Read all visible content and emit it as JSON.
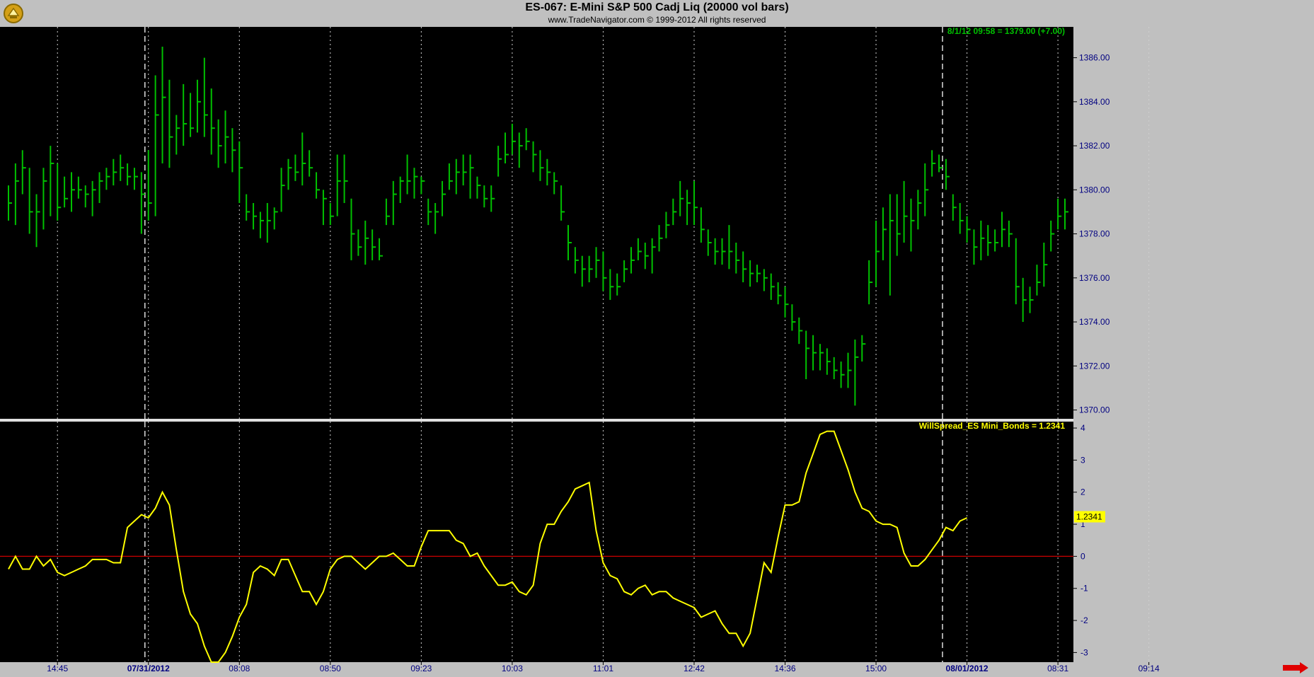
{
  "header": {
    "title": "ES-067:  E-Mini S&P 500 Cadj Liq  (20000 vol bars)",
    "subtitle": "www.TradeNavigator.com © 1999-2012  All rights reserved"
  },
  "icons": {
    "logo": "trade-navigator-logo-icon",
    "scroll_right": "arrow-right-icon"
  },
  "colors": {
    "background": "#000000",
    "frame": "#c0c0c0",
    "price_bars": "#00c000",
    "indicator": "#ffff00",
    "zero_line": "#cc0000",
    "axis_text": "#000080",
    "date_text": "#000080"
  },
  "chart_data": [
    {
      "type": "ohlc",
      "title": "ES-067:  E-Mini S&P 500 Cadj Liq  (20000 vol bars)",
      "last_value_label": "8/1/12 09:58 = 1379.00 (+7.00)",
      "ylim": [
        1369.6,
        1387.4
      ],
      "yticks": [
        "1370.00",
        "1372.00",
        "1374.00",
        "1376.00",
        "1378.00",
        "1380.00",
        "1382.00",
        "1384.00",
        "1386.00"
      ],
      "grid": "vertical dotted",
      "bars": [
        [
          1380.2,
          1378.6,
          1379.4
        ],
        [
          1381.2,
          1378.4,
          1380.4
        ],
        [
          1381.8,
          1379.8,
          1381.0
        ],
        [
          1381.0,
          1378.0,
          1379.0
        ],
        [
          1379.8,
          1377.4,
          1379.0
        ],
        [
          1381.0,
          1378.2,
          1380.4
        ],
        [
          1382.0,
          1378.8,
          1381.2
        ],
        [
          1381.2,
          1378.6,
          1379.2
        ],
        [
          1380.6,
          1379.2,
          1379.6
        ],
        [
          1380.8,
          1379.0,
          1380.0
        ],
        [
          1380.6,
          1379.6,
          1380.0
        ],
        [
          1380.2,
          1379.2,
          1379.8
        ],
        [
          1380.4,
          1378.8,
          1380.0
        ],
        [
          1380.8,
          1379.4,
          1380.4
        ],
        [
          1381.0,
          1380.0,
          1380.6
        ],
        [
          1381.4,
          1380.2,
          1380.8
        ],
        [
          1381.6,
          1380.4,
          1381.0
        ],
        [
          1381.2,
          1380.2,
          1380.6
        ],
        [
          1381.0,
          1380.0,
          1380.6
        ],
        [
          1380.8,
          1378.0,
          1379.8
        ],
        [
          1381.8,
          1378.6,
          1379.4
        ],
        [
          1385.2,
          1378.8,
          1383.4
        ],
        [
          1386.5,
          1381.2,
          1384.2
        ],
        [
          1385.0,
          1381.0,
          1382.4
        ],
        [
          1383.4,
          1381.6,
          1382.8
        ],
        [
          1384.8,
          1382.0,
          1383.0
        ],
        [
          1384.4,
          1382.4,
          1382.8
        ],
        [
          1385.0,
          1382.6,
          1384.0
        ],
        [
          1386.0,
          1382.4,
          1383.4
        ],
        [
          1384.6,
          1381.6,
          1382.8
        ],
        [
          1383.2,
          1381.0,
          1382.0
        ],
        [
          1383.6,
          1381.2,
          1382.4
        ],
        [
          1382.8,
          1380.8,
          1381.8
        ],
        [
          1382.2,
          1379.4,
          1381.0
        ],
        [
          1379.8,
          1378.6,
          1379.0
        ],
        [
          1379.4,
          1378.2,
          1378.8
        ],
        [
          1379.0,
          1377.8,
          1378.6
        ],
        [
          1379.4,
          1377.6,
          1378.6
        ],
        [
          1379.2,
          1378.2,
          1379.0
        ],
        [
          1381.0,
          1379.0,
          1380.2
        ],
        [
          1381.4,
          1380.0,
          1381.0
        ],
        [
          1381.6,
          1380.4,
          1380.8
        ],
        [
          1382.6,
          1380.2,
          1381.2
        ],
        [
          1381.8,
          1380.6,
          1381.0
        ],
        [
          1380.8,
          1379.6,
          1380.0
        ],
        [
          1380.0,
          1378.4,
          1379.6
        ],
        [
          1379.4,
          1378.4,
          1378.8
        ],
        [
          1381.6,
          1378.8,
          1380.4
        ],
        [
          1381.6,
          1379.4,
          1380.4
        ],
        [
          1379.6,
          1376.8,
          1378.0
        ],
        [
          1378.2,
          1377.0,
          1377.4
        ],
        [
          1378.6,
          1376.6,
          1377.8
        ],
        [
          1378.2,
          1376.8,
          1377.4
        ],
        [
          1377.8,
          1376.8,
          1377.0
        ],
        [
          1379.6,
          1378.4,
          1378.8
        ],
        [
          1380.4,
          1378.4,
          1379.8
        ],
        [
          1380.6,
          1379.4,
          1380.4
        ],
        [
          1381.6,
          1379.8,
          1380.4
        ],
        [
          1381.0,
          1379.6,
          1380.6
        ],
        [
          1380.6,
          1379.8,
          1380.4
        ],
        [
          1379.6,
          1378.4,
          1379.0
        ],
        [
          1379.4,
          1378.0,
          1379.0
        ],
        [
          1380.4,
          1378.8,
          1379.8
        ],
        [
          1381.2,
          1380.0,
          1380.4
        ],
        [
          1381.4,
          1379.8,
          1380.8
        ],
        [
          1381.6,
          1380.2,
          1380.8
        ],
        [
          1381.6,
          1379.6,
          1381.0
        ],
        [
          1380.6,
          1379.6,
          1380.2
        ],
        [
          1380.2,
          1379.2,
          1379.6
        ],
        [
          1380.2,
          1379.0,
          1379.6
        ],
        [
          1382.0,
          1380.6,
          1381.4
        ],
        [
          1382.6,
          1381.2,
          1381.6
        ],
        [
          1383.0,
          1381.6,
          1382.2
        ],
        [
          1382.6,
          1381.0,
          1382.0
        ],
        [
          1382.8,
          1381.8,
          1382.2
        ],
        [
          1382.2,
          1380.8,
          1381.6
        ],
        [
          1381.8,
          1380.4,
          1381.0
        ],
        [
          1381.4,
          1380.2,
          1380.8
        ],
        [
          1380.8,
          1379.8,
          1380.4
        ],
        [
          1380.2,
          1378.6,
          1379.0
        ],
        [
          1378.4,
          1376.8,
          1377.6
        ],
        [
          1377.4,
          1376.2,
          1376.8
        ],
        [
          1377.0,
          1375.6,
          1376.4
        ],
        [
          1377.0,
          1375.8,
          1376.4
        ],
        [
          1377.4,
          1376.0,
          1376.8
        ],
        [
          1377.2,
          1375.4,
          1376.0
        ],
        [
          1376.4,
          1375.0,
          1375.6
        ],
        [
          1376.2,
          1375.2,
          1375.6
        ],
        [
          1376.8,
          1375.8,
          1376.4
        ],
        [
          1377.4,
          1376.2,
          1376.8
        ],
        [
          1377.8,
          1376.8,
          1377.2
        ],
        [
          1377.6,
          1376.4,
          1377.0
        ],
        [
          1377.8,
          1376.2,
          1377.4
        ],
        [
          1378.4,
          1377.2,
          1377.8
        ],
        [
          1379.0,
          1377.8,
          1378.4
        ],
        [
          1379.6,
          1378.4,
          1379.0
        ],
        [
          1380.4,
          1378.8,
          1379.6
        ],
        [
          1380.0,
          1378.4,
          1379.4
        ],
        [
          1380.4,
          1378.4,
          1379.2
        ],
        [
          1379.2,
          1377.6,
          1378.2
        ],
        [
          1378.2,
          1377.0,
          1377.6
        ],
        [
          1377.8,
          1376.6,
          1377.2
        ],
        [
          1377.8,
          1376.6,
          1377.2
        ],
        [
          1378.4,
          1376.4,
          1377.2
        ],
        [
          1377.6,
          1376.2,
          1376.8
        ],
        [
          1377.2,
          1375.8,
          1376.4
        ],
        [
          1376.8,
          1375.6,
          1376.2
        ],
        [
          1376.6,
          1375.8,
          1376.2
        ],
        [
          1376.4,
          1375.4,
          1376.0
        ],
        [
          1376.2,
          1375.0,
          1375.6
        ],
        [
          1375.8,
          1374.8,
          1375.2
        ],
        [
          1375.6,
          1374.2,
          1374.8
        ],
        [
          1374.8,
          1373.6,
          1374.0
        ],
        [
          1374.2,
          1373.0,
          1373.6
        ],
        [
          1373.6,
          1371.4,
          1372.8
        ],
        [
          1373.4,
          1371.8,
          1372.6
        ],
        [
          1373.0,
          1371.8,
          1372.6
        ],
        [
          1372.8,
          1371.6,
          1372.2
        ],
        [
          1372.4,
          1371.4,
          1371.8
        ],
        [
          1372.2,
          1371.0,
          1371.6
        ],
        [
          1372.6,
          1371.0,
          1371.8
        ],
        [
          1373.2,
          1370.2,
          1372.4
        ],
        [
          1373.4,
          1372.2,
          1373.0
        ],
        [
          1376.8,
          1374.8,
          1375.8
        ],
        [
          1378.6,
          1375.6,
          1377.2
        ],
        [
          1379.2,
          1376.8,
          1378.2
        ],
        [
          1379.8,
          1375.2,
          1378.6
        ],
        [
          1379.8,
          1377.0,
          1378.0
        ],
        [
          1380.4,
          1377.6,
          1378.8
        ],
        [
          1379.6,
          1377.2,
          1378.6
        ],
        [
          1380.0,
          1378.2,
          1379.4
        ],
        [
          1381.2,
          1378.8,
          1380.0
        ],
        [
          1381.8,
          1380.6,
          1381.2
        ],
        [
          1381.6,
          1380.8,
          1381.0
        ],
        [
          1381.4,
          1380.0,
          1380.6
        ],
        [
          1379.8,
          1378.6,
          1379.2
        ],
        [
          1379.4,
          1378.0,
          1378.6
        ],
        [
          1378.8,
          1377.6,
          1378.2
        ],
        [
          1378.2,
          1376.6,
          1377.4
        ],
        [
          1378.6,
          1376.8,
          1377.8
        ],
        [
          1378.4,
          1377.0,
          1377.6
        ],
        [
          1378.2,
          1377.2,
          1377.6
        ],
        [
          1379.0,
          1377.4,
          1378.2
        ],
        [
          1378.6,
          1377.4,
          1378.0
        ],
        [
          1377.8,
          1374.8,
          1375.6
        ],
        [
          1376.0,
          1374.0,
          1375.0
        ],
        [
          1375.6,
          1374.4,
          1375.0
        ],
        [
          1376.6,
          1375.2,
          1375.8
        ],
        [
          1377.6,
          1375.6,
          1376.6
        ],
        [
          1378.6,
          1377.2,
          1378.0
        ],
        [
          1379.6,
          1378.2,
          1378.8
        ],
        [
          1379.6,
          1378.2,
          1379.0
        ]
      ]
    },
    {
      "type": "line",
      "series": [
        {
          "name": "WillSpread_ES Mini_Bonds",
          "values": [
            -0.4,
            0.0,
            -0.4,
            -0.4,
            0.0,
            -0.3,
            -0.1,
            -0.5,
            -0.6,
            -0.5,
            -0.4,
            -0.3,
            -0.1,
            -0.1,
            -0.1,
            -0.2,
            -0.2,
            0.9,
            1.1,
            1.3,
            1.2,
            1.5,
            2.0,
            1.6,
            0.2,
            -1.1,
            -1.8,
            -2.1,
            -2.8,
            -3.3,
            -3.3,
            -3.0,
            -2.5,
            -1.9,
            -1.5,
            -0.5,
            -0.3,
            -0.4,
            -0.6,
            -0.1,
            -0.1,
            -0.6,
            -1.1,
            -1.1,
            -1.5,
            -1.1,
            -0.4,
            -0.1,
            0.0,
            0.0,
            -0.2,
            -0.4,
            -0.2,
            0.0,
            0.0,
            0.1,
            -0.1,
            -0.3,
            -0.3,
            0.3,
            0.8,
            0.8,
            0.8,
            0.8,
            0.5,
            0.4,
            0.0,
            0.1,
            -0.3,
            -0.6,
            -0.9,
            -0.9,
            -0.8,
            -1.1,
            -1.2,
            -0.9,
            0.4,
            1.0,
            1.0,
            1.4,
            1.7,
            2.1,
            2.2,
            2.3,
            0.8,
            -0.2,
            -0.6,
            -0.7,
            -1.1,
            -1.2,
            -1.0,
            -0.9,
            -1.2,
            -1.1,
            -1.1,
            -1.3,
            -1.4,
            -1.5,
            -1.6,
            -1.9,
            -1.8,
            -1.7,
            -2.1,
            -2.4,
            -2.4,
            -2.8,
            -2.4,
            -1.3,
            -0.2,
            -0.5,
            0.6,
            1.6,
            1.6,
            1.7,
            2.6,
            3.2,
            3.8,
            3.9,
            3.9,
            3.3,
            2.7,
            2.0,
            1.5,
            1.4,
            1.1,
            1.0,
            1.0,
            0.9,
            0.1,
            -0.3,
            -0.3,
            -0.1,
            0.2,
            0.5,
            0.9,
            0.8,
            1.1,
            1.2
          ]
        }
      ],
      "last_value_label": "WillSpread_ES Mini_Bonds = 1.2341",
      "last_value_marker": "1.2341",
      "ylim": [
        -3.3,
        4.2
      ],
      "yticks": [
        "-3",
        "-2",
        "-1",
        "0",
        "1",
        "2",
        "3",
        "4"
      ],
      "reference_line": 0
    }
  ],
  "x_axis": {
    "labels": [
      {
        "text": "14:45",
        "bar": 7,
        "type": "time"
      },
      {
        "text": "07/31/2012",
        "bar": 20,
        "type": "date"
      },
      {
        "text": "08:08",
        "bar": 33,
        "type": "time"
      },
      {
        "text": "08:50",
        "bar": 46,
        "type": "time"
      },
      {
        "text": "09:23",
        "bar": 59,
        "type": "time"
      },
      {
        "text": "10:03",
        "bar": 72,
        "type": "time"
      },
      {
        "text": "11:01",
        "bar": 85,
        "type": "time"
      },
      {
        "text": "12:42",
        "bar": 98,
        "type": "time"
      },
      {
        "text": "14:36",
        "bar": 111,
        "type": "time"
      },
      {
        "text": "15:00",
        "bar": 124,
        "type": "time"
      },
      {
        "text": "08/01/2012",
        "bar": 137,
        "type": "date"
      },
      {
        "text": "08:31",
        "bar": 150,
        "type": "time"
      },
      {
        "text": "09:14",
        "bar": 163,
        "type": "time"
      }
    ],
    "session_breaks": [
      19.5,
      133.5
    ]
  }
}
